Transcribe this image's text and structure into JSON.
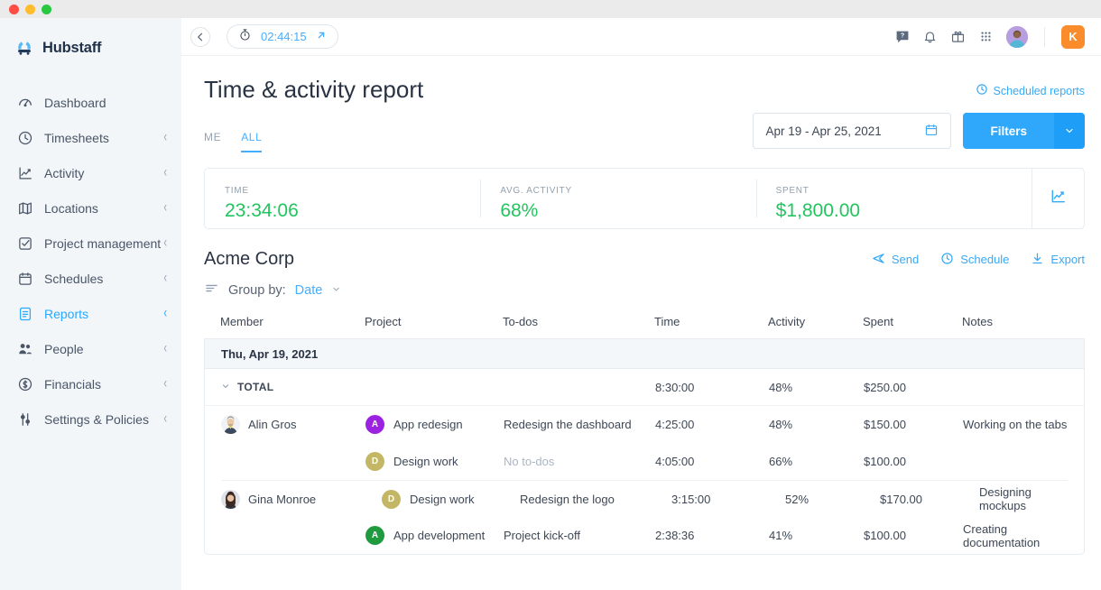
{
  "window": {
    "dots": [
      "red",
      "yellow",
      "green"
    ]
  },
  "brand": {
    "name": "Hubstaff"
  },
  "sidebar": {
    "items": [
      {
        "label": "Dashboard",
        "icon": "dashboard-icon",
        "expandable": false,
        "active": false
      },
      {
        "label": "Timesheets",
        "icon": "clock-icon",
        "expandable": true,
        "active": false
      },
      {
        "label": "Activity",
        "icon": "activity-chart-icon",
        "expandable": true,
        "active": false
      },
      {
        "label": "Locations",
        "icon": "map-icon",
        "expandable": true,
        "active": false
      },
      {
        "label": "Project management",
        "icon": "checkbox-icon",
        "expandable": true,
        "active": false
      },
      {
        "label": "Schedules",
        "icon": "calendar-icon",
        "expandable": true,
        "active": false
      },
      {
        "label": "Reports",
        "icon": "report-icon",
        "expandable": true,
        "active": true
      },
      {
        "label": "People",
        "icon": "people-icon",
        "expandable": true,
        "active": false
      },
      {
        "label": "Financials",
        "icon": "dollar-circle-icon",
        "expandable": true,
        "active": false
      },
      {
        "label": "Settings & Policies",
        "icon": "sliders-icon",
        "expandable": true,
        "active": false
      }
    ]
  },
  "topbar": {
    "back_icon": "arrow-left-icon",
    "timer": {
      "icon": "stopwatch-icon",
      "value": "02:44:15",
      "open_icon": "arrow-up-right-icon"
    },
    "icons": [
      "help-icon",
      "bell-icon",
      "gift-icon",
      "apps-grid-icon"
    ],
    "user_initial": "K",
    "user_badge_color": "#fb8c2c"
  },
  "header": {
    "title": "Time & activity report",
    "scheduled_reports": "Scheduled reports",
    "scheduled_reports_icon": "clock-icon",
    "tabs": [
      {
        "label": "ME",
        "active": false
      },
      {
        "label": "ALL",
        "active": true
      }
    ],
    "date_range": "Apr 19 - Apr 25, 2021",
    "date_icon": "calendar-icon",
    "filters_label": "Filters",
    "filters_caret_icon": "chevron-down-icon"
  },
  "stats": [
    {
      "label": "TIME",
      "value": "23:34:06"
    },
    {
      "label": "AVG. ACTIVITY",
      "value": "68%"
    },
    {
      "label": "SPENT",
      "value": "$1,800.00"
    }
  ],
  "stats_chart_icon": "line-chart-icon",
  "report": {
    "company": "Acme Corp",
    "actions": [
      {
        "label": "Send",
        "icon": "send-icon"
      },
      {
        "label": "Schedule",
        "icon": "clock-icon"
      },
      {
        "label": "Export",
        "icon": "download-icon"
      }
    ],
    "group_by_icon": "sort-lines-icon",
    "group_by_text": "Group by:",
    "group_by_value": "Date",
    "group_by_caret_icon": "chevron-down-icon"
  },
  "table": {
    "columns": [
      "Member",
      "Project",
      "To-dos",
      "Time",
      "Activity",
      "Spent",
      "Notes"
    ],
    "group_label": "Thu, Apr 19, 2021",
    "total": {
      "label": "TOTAL",
      "caret_icon": "chevron-down-icon",
      "time": "8:30:00",
      "activity": "48%",
      "spent": "$250.00"
    },
    "rows": [
      {
        "member": "Alin Gros",
        "avatar": "alin-avatar",
        "project": "App redesign",
        "project_initial": "A",
        "project_color": "#9a22e0",
        "todos": "Redesign the dashboard",
        "todos_muted": false,
        "time": "4:25:00",
        "activity": "48%",
        "spent": "$150.00",
        "notes": "Working on the tabs",
        "group_start": true
      },
      {
        "member": "",
        "avatar": "",
        "project": "Design work",
        "project_initial": "D",
        "project_color": "#c3b765",
        "todos": "No to-dos",
        "todos_muted": true,
        "time": "4:05:00",
        "activity": "66%",
        "spent": "$100.00",
        "notes": "",
        "group_start": false
      },
      {
        "member": "Gina Monroe",
        "avatar": "gina-avatar",
        "project": "Design work",
        "project_initial": "D",
        "project_color": "#c3b765",
        "todos": "Redesign the logo",
        "todos_muted": false,
        "time": "3:15:00",
        "activity": "52%",
        "spent": "$170.00",
        "notes": "Designing mockups",
        "group_start": true
      },
      {
        "member": "",
        "avatar": "",
        "project": "App development",
        "project_initial": "A",
        "project_color": "#1f9a3f",
        "todos": "Project kick-off",
        "todos_muted": false,
        "time": "2:38:36",
        "activity": "41%",
        "spent": "$100.00",
        "notes": "Creating documentation",
        "group_start": false
      }
    ]
  }
}
